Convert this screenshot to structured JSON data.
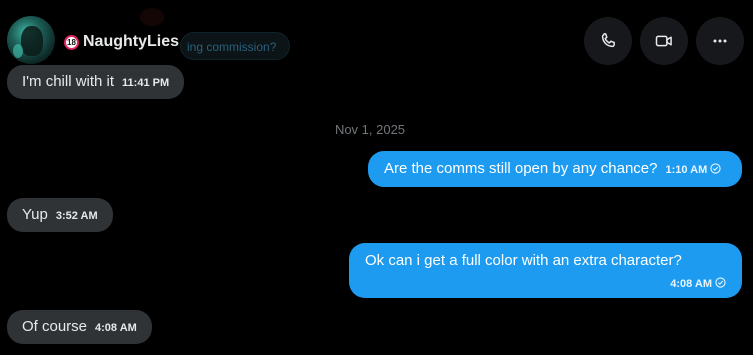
{
  "conversation": {
    "display_name": "NaughtyLies",
    "age_badge": "18",
    "ghost_snippet": "ing commission?"
  },
  "actions": {
    "call_icon": "phone-icon",
    "video_icon": "video-camera-icon",
    "more_icon": "more-horizontal-icon"
  },
  "colors": {
    "background": "#000000",
    "incoming_bubble": "#2f3336",
    "outgoing_bubble": "#1d9bf0",
    "action_button": "#16181c"
  },
  "messages": [
    {
      "text": "I'm chill with it",
      "time": "11:41 PM"
    },
    {
      "text": "Are the comms still open by any chance?",
      "time": "1:10 AM"
    },
    {
      "text": "Yup",
      "time": "3:52 AM"
    },
    {
      "text": "Ok can i get a full color with an extra character?",
      "time": "4:08 AM"
    },
    {
      "text": "Of course",
      "time": "4:08 AM"
    }
  ],
  "date_separator": "Nov 1, 2025"
}
